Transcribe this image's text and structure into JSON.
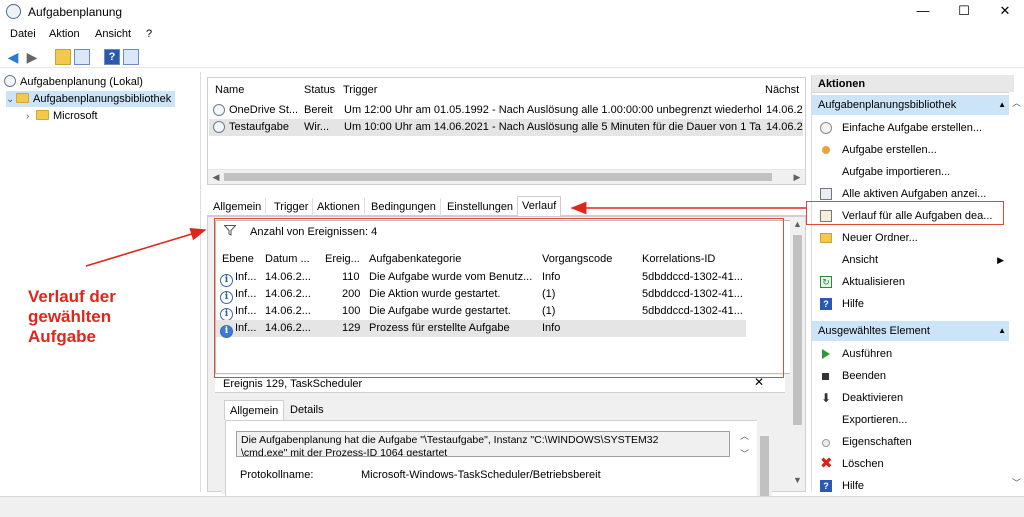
{
  "window": {
    "title": "Aufgabenplanung",
    "minimize_glyph": "—",
    "maximize_glyph": "☐",
    "close_glyph": "✕"
  },
  "menu": [
    "Datei",
    "Aktion",
    "Ansicht",
    "?"
  ],
  "toolbar_icons": [
    "back-icon",
    "forward-icon",
    "folder-up-icon",
    "console-tree-icon",
    "help-icon",
    "action-pane-icon"
  ],
  "tree": {
    "root": "Aufgabenplanung (Lokal)",
    "library": "Aufgabenplanungsbibliothek",
    "child": "Microsoft"
  },
  "task_list": {
    "columns": [
      "Name",
      "Status",
      "Trigger",
      "Nächst"
    ],
    "rows": [
      {
        "name": "OneDrive St...",
        "status": "Bereit",
        "trigger": "Um 12:00 Uhr am 01.05.1992 - Nach Auslösung alle 1.00:00:00 unbegrenzt wiederholen.",
        "next": "14.06.20"
      },
      {
        "name": "Testaufgabe",
        "status": "Wir...",
        "trigger": "Um 10:00 Uhr am 14.06.2021 - Nach Auslösung alle 5 Minuten für die Dauer von 1 Ta...",
        "next": "14.06.20"
      }
    ]
  },
  "tabs": [
    "Allgemein",
    "Trigger",
    "Aktionen",
    "Bedingungen",
    "Einstellungen",
    "Verlauf"
  ],
  "active_tab": "Verlauf",
  "history": {
    "filter_text": "Anzahl von Ereignissen: 4",
    "columns": [
      "Ebene",
      "Datum ...",
      "Ereig...",
      "Aufgabenkategorie",
      "Vorgangscode",
      "Korrelations-ID"
    ],
    "rows": [
      {
        "level": "Inf...",
        "date": "14.06.2...",
        "id": "110",
        "category": "Die Aufgabe wurde vom Benutz...",
        "opcode": "Info",
        "corr": "5dbddccd-1302-41..."
      },
      {
        "level": "Inf...",
        "date": "14.06.2...",
        "id": "200",
        "category": "Die Aktion wurde gestartet.",
        "opcode": "(1)",
        "corr": "5dbddccd-1302-41..."
      },
      {
        "level": "Inf...",
        "date": "14.06.2...",
        "id": "100",
        "category": "Die Aufgabe wurde gestartet.",
        "opcode": "(1)",
        "corr": "5dbddccd-1302-41..."
      },
      {
        "level": "Inf...",
        "date": "14.06.2...",
        "id": "129",
        "category": "Prozess für erstellte Aufgabe",
        "opcode": "Info",
        "corr": ""
      }
    ]
  },
  "detail": {
    "header": "Ereignis 129, TaskScheduler",
    "close_glyph": "✕",
    "tabs": [
      "Allgemein",
      "Details"
    ],
    "message_line1": "Die Aufgabenplanung hat die Aufgabe \"\\Testaufgabe\", Instanz \"C:\\WINDOWS\\SYSTEM32",
    "message_line2": "\\cmd.exe\" mit der Prozess-ID 1064 gestartet",
    "log_label": "Protokollname:",
    "log_value": "Microsoft-Windows-TaskScheduler/Betriebsbereit"
  },
  "actions_pane": {
    "title": "Aktionen",
    "section1": "Aufgabenplanungsbibliothek",
    "section1_items": [
      {
        "label": "Einfache Aufgabe erstellen...",
        "icon": "wizard-icon"
      },
      {
        "label": "Aufgabe erstellen...",
        "icon": "create-task-icon"
      },
      {
        "label": "Aufgabe importieren...",
        "icon": ""
      },
      {
        "label": "Alle aktiven Aufgaben anzei...",
        "icon": "running-tasks-icon"
      },
      {
        "label": "Verlauf für alle Aufgaben dea...",
        "icon": "history-icon"
      },
      {
        "label": "Neuer Ordner...",
        "icon": "new-folder-icon"
      },
      {
        "label": "Ansicht",
        "icon": ""
      },
      {
        "label": "Aktualisieren",
        "icon": "refresh-icon"
      },
      {
        "label": "Hilfe",
        "icon": "help-icon"
      }
    ],
    "section2": "Ausgewähltes Element",
    "section2_items": [
      {
        "label": "Ausführen",
        "icon": "run-icon"
      },
      {
        "label": "Beenden",
        "icon": "stop-icon"
      },
      {
        "label": "Deaktivieren",
        "icon": "disable-icon"
      },
      {
        "label": "Exportieren...",
        "icon": ""
      },
      {
        "label": "Eigenschaften",
        "icon": "properties-icon"
      },
      {
        "label": "Löschen",
        "icon": "delete-icon"
      },
      {
        "label": "Hilfe",
        "icon": "help-icon"
      }
    ]
  },
  "annotation": {
    "line1": "Verlauf der",
    "line2": "gewählten",
    "line3": "Aufgabe",
    "color": "#e0261b"
  }
}
